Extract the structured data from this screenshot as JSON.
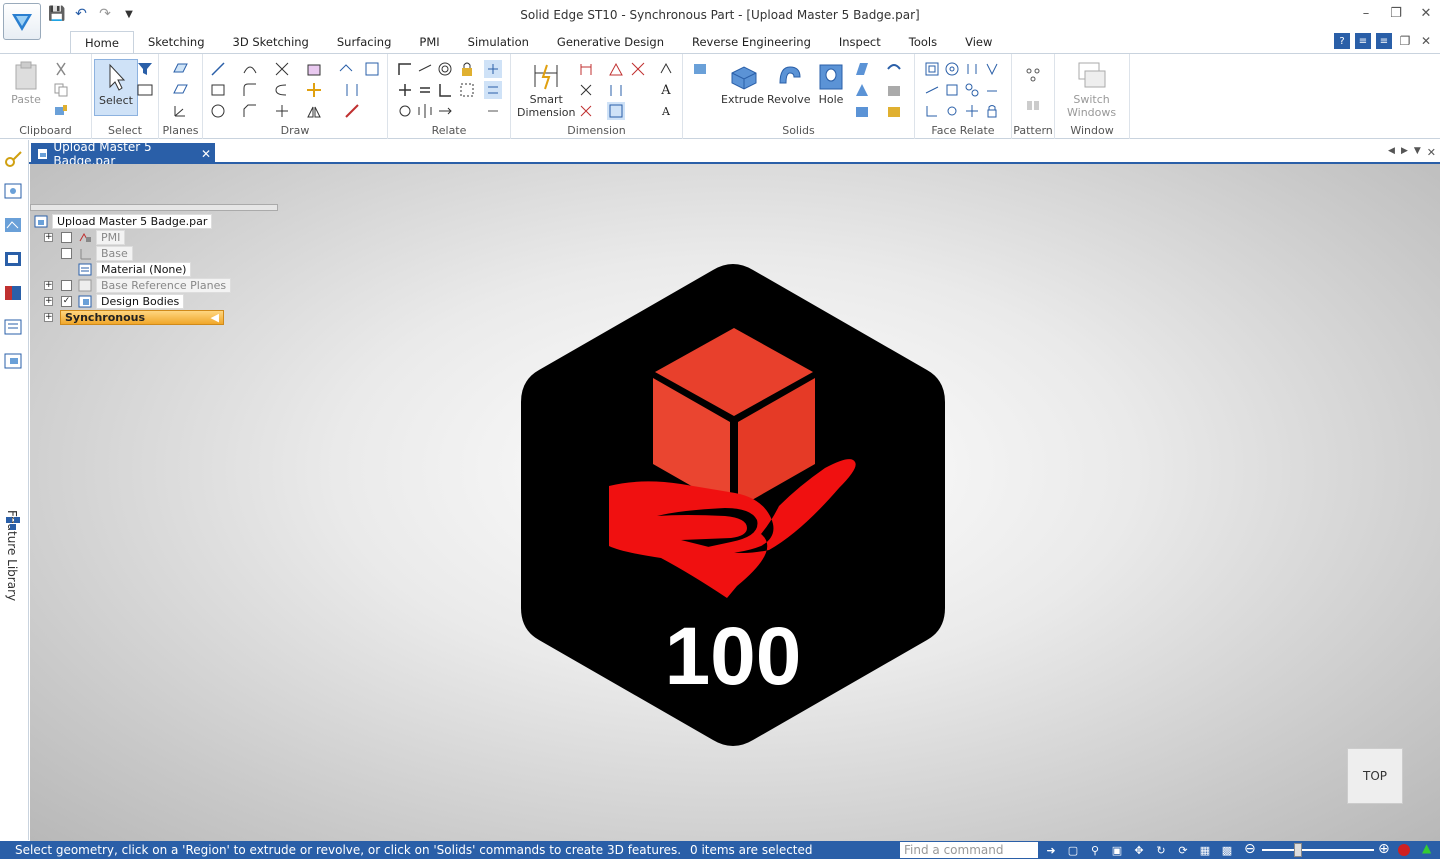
{
  "window": {
    "title": "Solid Edge ST10 - Synchronous Part - [Upload Master 5 Badge.par]",
    "controls": [
      "minimize-icon",
      "restore-icon",
      "close-icon"
    ]
  },
  "ribbon": {
    "tabs": [
      "Home",
      "Sketching",
      "3D Sketching",
      "Surfacing",
      "PMI",
      "Simulation",
      "Generative Design",
      "Reverse Engineering",
      "Inspect",
      "Tools",
      "View"
    ],
    "active_tab": "Home",
    "groups": {
      "clipboard": "Clipboard",
      "select": "Select",
      "planes": "Planes",
      "draw": "Draw",
      "relate": "Relate",
      "dimension": "Dimension",
      "solids": "Solids",
      "face_relate": "Face Relate",
      "pattern": "Pattern",
      "window": "Window"
    },
    "buttons": {
      "paste": "Paste",
      "select": "Select",
      "smart_dimension_1": "Smart",
      "smart_dimension_2": "Dimension",
      "extrude": "Extrude",
      "revolve": "Revolve",
      "hole": "Hole",
      "switch_windows_1": "Switch",
      "switch_windows_2": "Windows"
    }
  },
  "document": {
    "tab_label": "Upload Master 5 Badge.par"
  },
  "pathfinder": {
    "root": "Upload Master 5 Badge.par",
    "items": [
      {
        "label": "PMI",
        "checked": false,
        "expandable": true
      },
      {
        "label": "Base",
        "checked": false,
        "expandable": false
      },
      {
        "label": "Material (None)",
        "checked": null,
        "expandable": false
      },
      {
        "label": "Base Reference Planes",
        "checked": false,
        "expandable": true
      },
      {
        "label": "Design Bodies",
        "checked": true,
        "expandable": true
      },
      {
        "label": "Synchronous",
        "checked": null,
        "expandable": true
      }
    ]
  },
  "side_panel": {
    "feature_library": "Feature Library"
  },
  "viewport": {
    "badge_number": "100",
    "view_cube_label": "TOP",
    "badge_colors": {
      "hex": "#000000",
      "cube": "#e8402c",
      "hand": "#f01010",
      "text": "#ffffff"
    }
  },
  "status": {
    "prompt": "Select geometry, click on a 'Region' to extrude or revolve, or click on 'Solids' commands to create 3D features.",
    "selection": "0 items are selected",
    "find_command_placeholder": "Find a command"
  },
  "colors": {
    "accent": "#2a5fa8",
    "synchronous_highlight": "#f0a72a"
  }
}
